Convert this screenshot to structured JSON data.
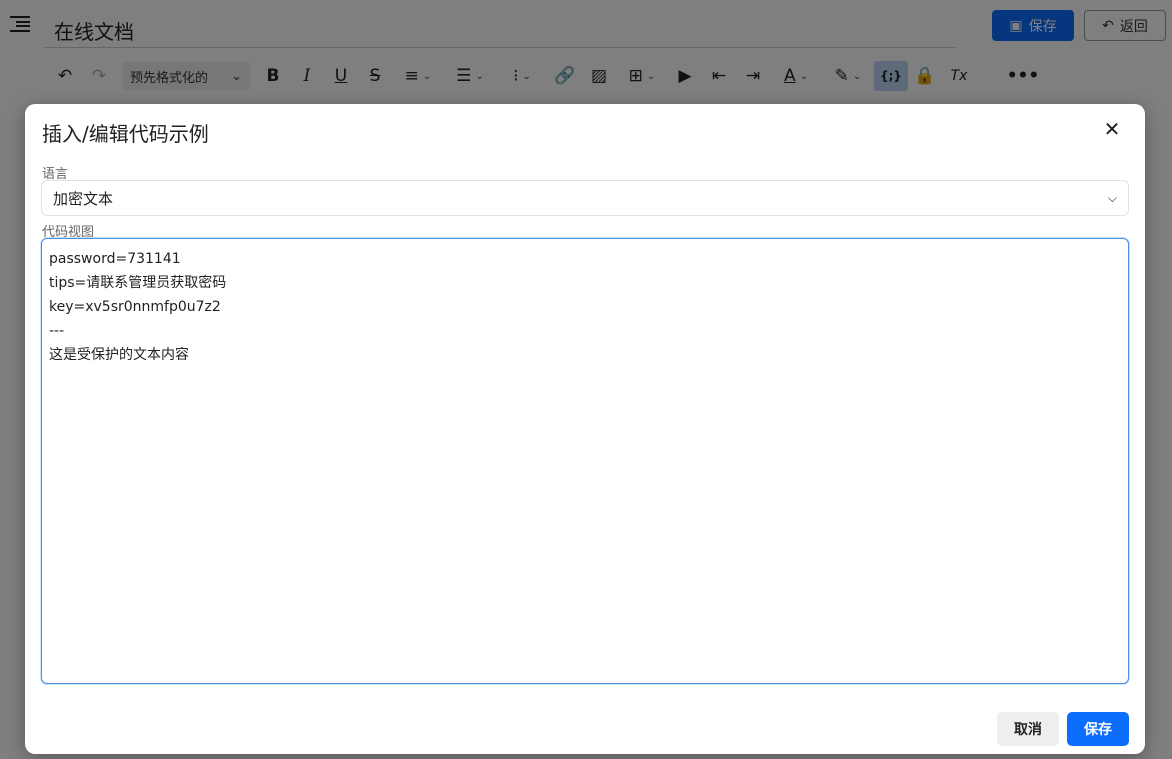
{
  "header": {
    "doc_title": "在线文档",
    "save_label": "保存",
    "back_label": "返回"
  },
  "toolbar": {
    "block_format": "预先格式化的",
    "text_color_glyph": "A",
    "bold_glyph": "B",
    "italic_glyph": "I",
    "underline_glyph": "U",
    "strike_glyph": "S",
    "clear_format_glyph": "Tx",
    "code_sample_glyph": "{;}"
  },
  "dialog": {
    "title": "插入/编辑代码示例",
    "language_label": "语言",
    "language_value": "加密文本",
    "code_label": "代码视图",
    "code_value": "password=731141\ntips=请联系管理员获取密码\nkey=xv5sr0nnmfp0u7z2\n---\n这是受保护的文本内容",
    "cancel_label": "取消",
    "save_label": "保存"
  },
  "colors": {
    "primary": "#0d6efd",
    "overlay": "rgba(0,0,0,0.5)"
  }
}
